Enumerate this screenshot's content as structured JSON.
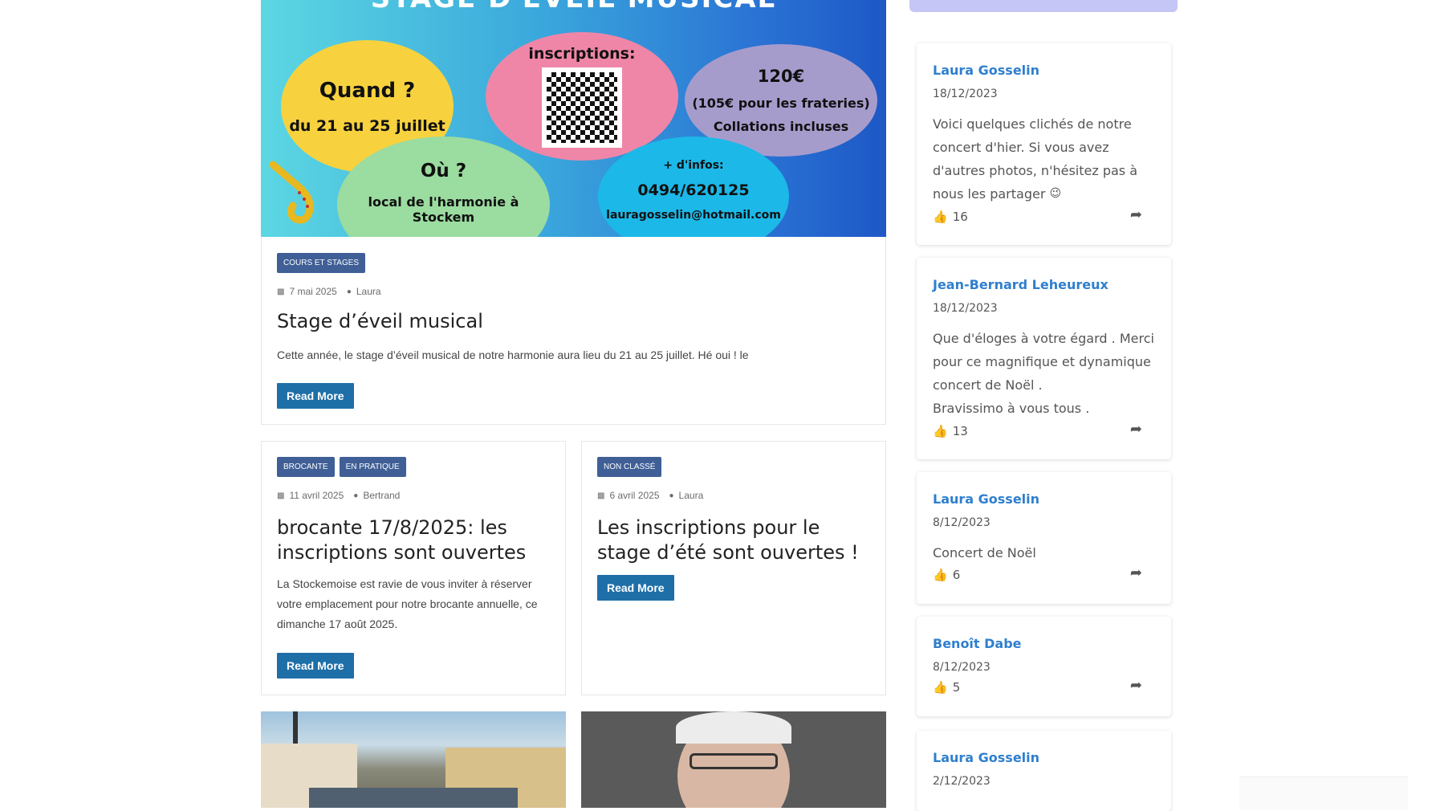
{
  "featured": {
    "poster": {
      "title": "STAGE D'ÉVEIL MUSICAL",
      "quand": "Quand ?",
      "dates": "du 21 au 25 juillet",
      "inscriptions": "inscriptions:",
      "price": "120€",
      "price_note": "(105€ pour les frateries)",
      "collations": "Collations incluses",
      "ou": "Où ?",
      "lieu": "local de l'harmonie à Stockem",
      "infos": "+ d'infos:",
      "phone": "0494/620125",
      "email": "lauragosselin@hotmail.com"
    },
    "category": "COURS ET STAGES",
    "date": "7 mai 2025",
    "author": "Laura",
    "title": "Stage d’éveil musical",
    "excerpt": "Cette année, le stage d’éveil musical de notre harmonie aura lieu du 21 au 25 juillet. Hé oui ! le",
    "read_more": "Read More"
  },
  "posts": [
    {
      "categories": [
        "BROCANTE",
        "EN PRATIQUE"
      ],
      "date": "11 avril 2025",
      "author": "Bertrand",
      "title": "brocante 17/8/2025: les inscriptions sont ouvertes",
      "excerpt": "La Stockemoise est ravie de vous inviter à réserver votre emplacement pour notre brocante annuelle, ce dimanche 17 août 2025.",
      "read_more": "Read More"
    },
    {
      "categories": [
        "NON CLASSÉ"
      ],
      "date": "6 avril 2025",
      "author": "Laura",
      "title": "Les inscriptions pour le stage d’été sont ouvertes !",
      "read_more": "Read More"
    }
  ],
  "comments": [
    {
      "name": "Laura Gosselin",
      "date": "18/12/2023",
      "text": "Voici quelques clichés de notre concert d'hier. Si vous avez d'autres photos, n'hésitez pas à nous les partager",
      "emoji": "😉",
      "likes": "16"
    },
    {
      "name": "Jean-Bernard Leheureux",
      "date": "18/12/2023",
      "text": "Que d'éloges à votre égard . Merci pour ce magnifique et dynamique concert de Noël .",
      "text2": "Bravissimo à vous tous .",
      "likes": "13"
    },
    {
      "name": "Laura Gosselin",
      "date": "8/12/2023",
      "text": "Concert de Noël",
      "likes": "6"
    },
    {
      "name": "Benoît Dabe",
      "date": "8/12/2023",
      "likes": "5"
    },
    {
      "name": "Laura Gosselin",
      "date": "2/12/2023"
    }
  ],
  "icons": {
    "calendar": "calendar-icon",
    "user": "user-icon",
    "like": "thumbs-up-icon",
    "share": "share-icon"
  },
  "colors": {
    "badge": "#3f5f96",
    "button": "#1e6fa8",
    "fb_name": "#2f7fce",
    "sidebar_top": "#c5c6f5"
  }
}
